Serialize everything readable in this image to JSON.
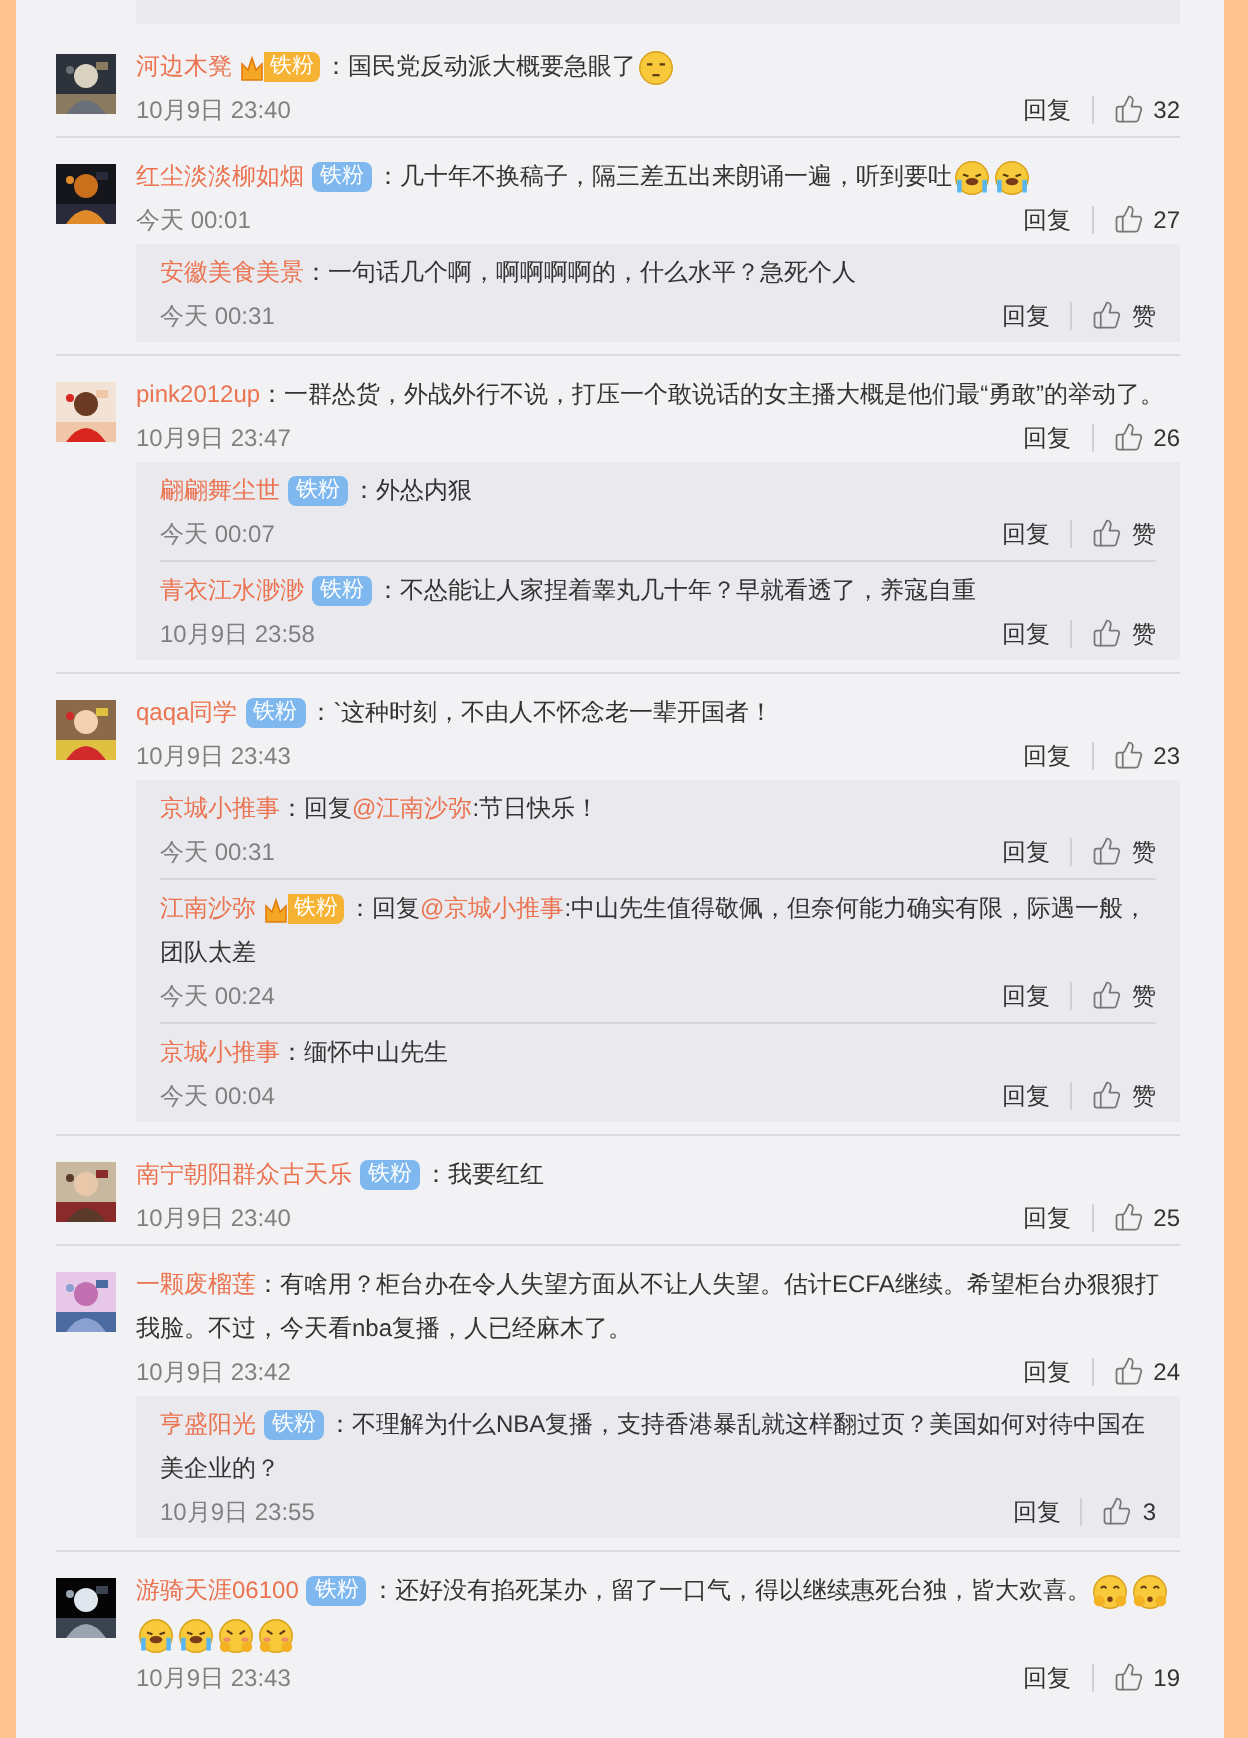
{
  "comments": [
    {
      "user": "河边木凳",
      "badge": {
        "label": "铁粉",
        "kind": "crown"
      },
      "text": "：国民党反动派大概要急眼了",
      "emojis": [
        {
          "kind": "sleepy"
        }
      ],
      "time": "10月9日 23:40",
      "reply_label": "回复",
      "likes": "32"
    },
    {
      "user": "红尘淡淡柳如烟",
      "badge": {
        "label": "铁粉",
        "kind": "plain"
      },
      "text": "：几十年不换稿子，隔三差五出来朗诵一遍，听到要吐",
      "emojis": [
        {
          "kind": "tears"
        },
        {
          "kind": "tears"
        }
      ],
      "time": "今天 00:01",
      "reply_label": "回复",
      "likes": "27",
      "replies": [
        {
          "user": "安徽美食美景",
          "text": "：一句话几个啊，啊啊啊啊的，什么水平？急死个人",
          "time": "今天 00:31",
          "reply_label": "回复",
          "likes": "赞"
        }
      ]
    },
    {
      "user": "pink2012up",
      "text": "：一群怂货，外战外行不说，打压一个敢说话的女主播大概是他们最“勇敢”的举动了。",
      "time": "10月9日 23:47",
      "reply_label": "回复",
      "likes": "26",
      "replies": [
        {
          "user": "翩翩舞尘世",
          "badge": {
            "label": "铁粉",
            "kind": "plain"
          },
          "text": "：外怂内狠",
          "time": "今天 00:07",
          "reply_label": "回复",
          "likes": "赞"
        },
        {
          "user": "青衣江水渺渺",
          "badge": {
            "label": "铁粉",
            "kind": "plain"
          },
          "text": "：不怂能让人家捏着睾丸几十年？早就看透了，养寇自重",
          "time": "10月9日 23:58",
          "reply_label": "回复",
          "likes": "赞"
        }
      ]
    },
    {
      "user": "qaqa同学",
      "badge": {
        "label": "铁粉",
        "kind": "plain"
      },
      "text": "：`这种时刻，不由人不怀念老一辈开国者！",
      "time": "10月9日 23:43",
      "reply_label": "回复",
      "likes": "23",
      "replies": [
        {
          "user": "京城小推事",
          "text": "：回复",
          "mention": "@江南沙弥",
          "text_after": ":节日快乐！",
          "time": "今天 00:31",
          "reply_label": "回复",
          "likes": "赞"
        },
        {
          "user": "江南沙弥",
          "badge": {
            "label": "铁粉",
            "kind": "crown"
          },
          "text": "：回复",
          "mention": "@京城小推事",
          "text_after": ":中山先生值得敬佩，但奈何能力确实有限，际遇一般，团队太差",
          "time": "今天 00:24",
          "reply_label": "回复",
          "likes": "赞"
        },
        {
          "user": "京城小推事",
          "text": "：缅怀中山先生",
          "time": "今天 00:04",
          "reply_label": "回复",
          "likes": "赞"
        }
      ]
    },
    {
      "user": "南宁朝阳群众古天乐",
      "badge": {
        "label": "铁粉",
        "kind": "plain"
      },
      "text": "：我要红红",
      "time": "10月9日 23:40",
      "reply_label": "回复",
      "likes": "25"
    },
    {
      "user": "一颗废榴莲",
      "text": "：有啥用？柜台办在令人失望方面从不让人失望。估计ECFA继续。希望柜台办狠狠打我脸。不过，今天看nba复播，人已经麻木了。",
      "time": "10月9日 23:42",
      "reply_label": "回复",
      "likes": "24",
      "replies": [
        {
          "user": "亨盛阳光",
          "badge": {
            "label": "铁粉",
            "kind": "plain"
          },
          "text": "：不理解为什么NBA复播，支持香港暴乱就这样翻过页？美国如何对待中国在美企业的？",
          "time": "10月9日 23:55",
          "reply_label": "回复",
          "likes": "3"
        }
      ]
    },
    {
      "user": "游骑天涯06100",
      "badge": {
        "label": "铁粉",
        "kind": "plain"
      },
      "text": "：还好没有掐死某办，留了一口气，得以继续惠死台独，皆大欢喜。",
      "emojis": [
        {
          "kind": "shy"
        },
        {
          "kind": "shy"
        },
        {
          "kind": "tears"
        },
        {
          "kind": "tears"
        },
        {
          "kind": "blush"
        },
        {
          "kind": "blush"
        }
      ],
      "time": "10月9日 23:43",
      "reply_label": "回复",
      "likes": "19"
    }
  ]
}
